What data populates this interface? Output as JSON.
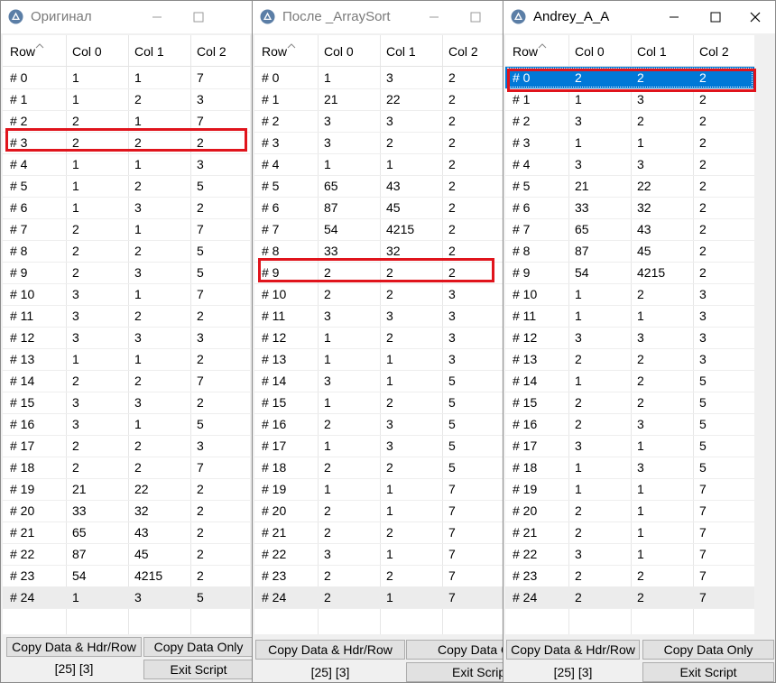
{
  "columns": [
    "Row",
    "Col 0",
    "Col 1",
    "Col 2"
  ],
  "windows": [
    {
      "title": "Оригинал",
      "rows": [
        [
          "# 0",
          "1",
          "1",
          "7"
        ],
        [
          "# 1",
          "1",
          "2",
          "3"
        ],
        [
          "# 2",
          "2",
          "1",
          "7"
        ],
        [
          "# 3",
          "2",
          "2",
          "2"
        ],
        [
          "# 4",
          "1",
          "1",
          "3"
        ],
        [
          "# 5",
          "1",
          "2",
          "5"
        ],
        [
          "# 6",
          "1",
          "3",
          "2"
        ],
        [
          "# 7",
          "2",
          "1",
          "7"
        ],
        [
          "# 8",
          "2",
          "2",
          "5"
        ],
        [
          "# 9",
          "2",
          "3",
          "5"
        ],
        [
          "# 10",
          "3",
          "1",
          "7"
        ],
        [
          "# 11",
          "3",
          "2",
          "2"
        ],
        [
          "# 12",
          "3",
          "3",
          "3"
        ],
        [
          "# 13",
          "1",
          "1",
          "2"
        ],
        [
          "# 14",
          "2",
          "2",
          "7"
        ],
        [
          "# 15",
          "3",
          "3",
          "2"
        ],
        [
          "# 16",
          "3",
          "1",
          "5"
        ],
        [
          "# 17",
          "2",
          "2",
          "3"
        ],
        [
          "# 18",
          "2",
          "2",
          "7"
        ],
        [
          "# 19",
          "21",
          "22",
          "2"
        ],
        [
          "# 20",
          "33",
          "32",
          "2"
        ],
        [
          "# 21",
          "65",
          "43",
          "2"
        ],
        [
          "# 22",
          "87",
          "45",
          "2"
        ],
        [
          "# 23",
          "54",
          "4215",
          "2"
        ],
        [
          "# 24",
          "1",
          "3",
          "5"
        ]
      ],
      "copy_hdr_label": "Copy Data & Hdr/Row",
      "copy_only_label": "Copy Data Only",
      "status": "[25] [3]",
      "exit_label": "Exit Script"
    },
    {
      "title": "После _ArraySort",
      "rows": [
        [
          "# 0",
          "1",
          "3",
          "2"
        ],
        [
          "# 1",
          "21",
          "22",
          "2"
        ],
        [
          "# 2",
          "3",
          "3",
          "2"
        ],
        [
          "# 3",
          "3",
          "2",
          "2"
        ],
        [
          "# 4",
          "1",
          "1",
          "2"
        ],
        [
          "# 5",
          "65",
          "43",
          "2"
        ],
        [
          "# 6",
          "87",
          "45",
          "2"
        ],
        [
          "# 7",
          "54",
          "4215",
          "2"
        ],
        [
          "# 8",
          "33",
          "32",
          "2"
        ],
        [
          "# 9",
          "2",
          "2",
          "2"
        ],
        [
          "# 10",
          "2",
          "2",
          "3"
        ],
        [
          "# 11",
          "3",
          "3",
          "3"
        ],
        [
          "# 12",
          "1",
          "2",
          "3"
        ],
        [
          "# 13",
          "1",
          "1",
          "3"
        ],
        [
          "# 14",
          "3",
          "1",
          "5"
        ],
        [
          "# 15",
          "1",
          "2",
          "5"
        ],
        [
          "# 16",
          "2",
          "3",
          "5"
        ],
        [
          "# 17",
          "1",
          "3",
          "5"
        ],
        [
          "# 18",
          "2",
          "2",
          "5"
        ],
        [
          "# 19",
          "1",
          "1",
          "7"
        ],
        [
          "# 20",
          "2",
          "1",
          "7"
        ],
        [
          "# 21",
          "2",
          "2",
          "7"
        ],
        [
          "# 22",
          "3",
          "1",
          "7"
        ],
        [
          "# 23",
          "2",
          "2",
          "7"
        ],
        [
          "# 24",
          "2",
          "1",
          "7"
        ]
      ],
      "copy_hdr_label": "Copy Data & Hdr/Row",
      "copy_only_label": "Copy Data Only",
      "status": "[25] [3]",
      "exit_label": "Exit Script"
    },
    {
      "title": "Andrey_A_A",
      "rows": [
        [
          "# 0",
          "2",
          "2",
          "2"
        ],
        [
          "# 1",
          "1",
          "3",
          "2"
        ],
        [
          "# 2",
          "3",
          "2",
          "2"
        ],
        [
          "# 3",
          "1",
          "1",
          "2"
        ],
        [
          "# 4",
          "3",
          "3",
          "2"
        ],
        [
          "# 5",
          "21",
          "22",
          "2"
        ],
        [
          "# 6",
          "33",
          "32",
          "2"
        ],
        [
          "# 7",
          "65",
          "43",
          "2"
        ],
        [
          "# 8",
          "87",
          "45",
          "2"
        ],
        [
          "# 9",
          "54",
          "4215",
          "2"
        ],
        [
          "# 10",
          "1",
          "2",
          "3"
        ],
        [
          "# 11",
          "1",
          "1",
          "3"
        ],
        [
          "# 12",
          "3",
          "3",
          "3"
        ],
        [
          "# 13",
          "2",
          "2",
          "3"
        ],
        [
          "# 14",
          "1",
          "2",
          "5"
        ],
        [
          "# 15",
          "2",
          "2",
          "5"
        ],
        [
          "# 16",
          "2",
          "3",
          "5"
        ],
        [
          "# 17",
          "3",
          "1",
          "5"
        ],
        [
          "# 18",
          "1",
          "3",
          "5"
        ],
        [
          "# 19",
          "1",
          "1",
          "7"
        ],
        [
          "# 20",
          "2",
          "1",
          "7"
        ],
        [
          "# 21",
          "2",
          "1",
          "7"
        ],
        [
          "# 22",
          "3",
          "1",
          "7"
        ],
        [
          "# 23",
          "2",
          "2",
          "7"
        ],
        [
          "# 24",
          "2",
          "2",
          "7"
        ]
      ],
      "copy_hdr_label": "Copy Data & Hdr/Row",
      "copy_only_label": "Copy Data Only",
      "status": "[25] [3]",
      "exit_label": "Exit Script"
    }
  ],
  "colors": {
    "selection": "#0078d7",
    "highlight_box": "#e0141c",
    "button_face": "#e1e1e1"
  },
  "icons": {
    "app": "autoit-triangle-icon",
    "minimize": "minimize-icon",
    "maximize": "maximize-icon",
    "close": "close-icon",
    "sort": "sort-caret-icon"
  }
}
